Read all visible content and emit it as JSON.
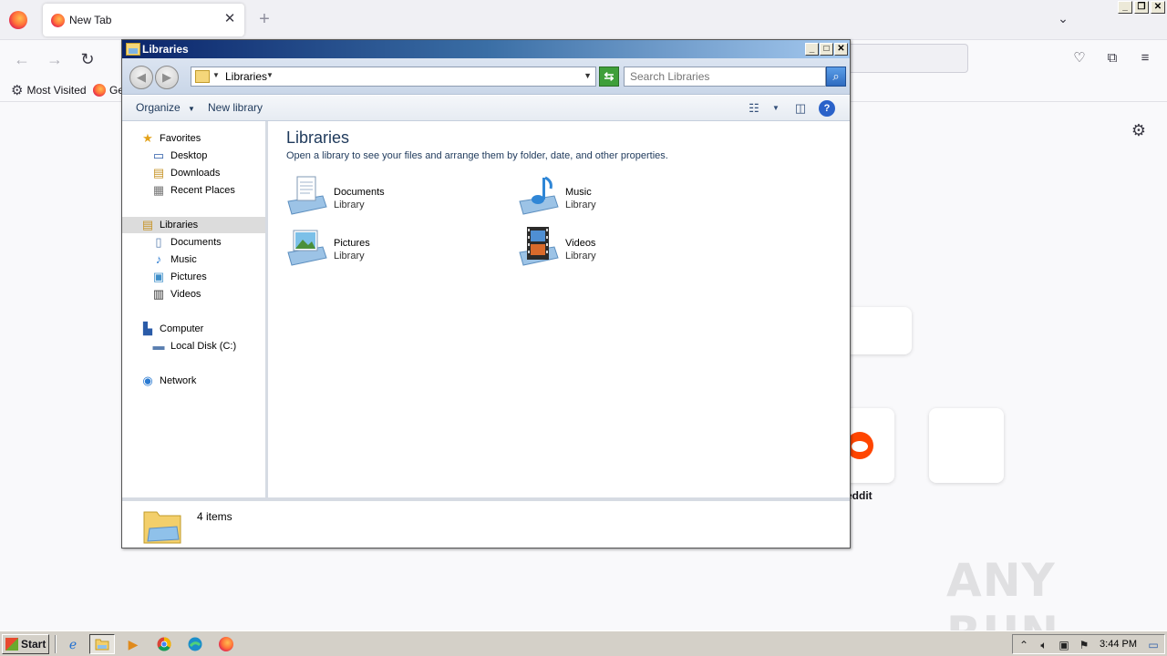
{
  "firefox": {
    "tab_title": "New Tab",
    "tab_close": "✕",
    "new_tab": "+",
    "bookmarks": [
      {
        "label": "Most Visited",
        "icon": "gear-icon"
      },
      {
        "label": "Ge",
        "icon": "firefox-icon"
      }
    ],
    "tiles": [
      {
        "label": "eddit",
        "icon": "reddit-icon"
      }
    ]
  },
  "explorer": {
    "title": "Libraries",
    "address_text": "Libraries",
    "search_placeholder": "Search Libraries",
    "toolbar": {
      "organize": "Organize",
      "new_library": "New library"
    },
    "nav": {
      "favorites": "Favorites",
      "favorites_items": [
        "Desktop",
        "Downloads",
        "Recent Places"
      ],
      "libraries": "Libraries",
      "libraries_items": [
        "Documents",
        "Music",
        "Pictures",
        "Videos"
      ],
      "computer": "Computer",
      "computer_items": [
        "Local Disk (C:)"
      ],
      "network": "Network"
    },
    "content": {
      "heading": "Libraries",
      "description": "Open a library to see your files and arrange them by folder, date, and other properties.",
      "libraries": [
        {
          "name": "Documents",
          "sub": "Library",
          "icon": "documents-library-icon"
        },
        {
          "name": "Music",
          "sub": "Library",
          "icon": "music-library-icon"
        },
        {
          "name": "Pictures",
          "sub": "Library",
          "icon": "pictures-library-icon"
        },
        {
          "name": "Videos",
          "sub": "Library",
          "icon": "videos-library-icon"
        }
      ]
    },
    "details": {
      "count": "4 items"
    }
  },
  "taskbar": {
    "start": "Start",
    "time": "3:44 PM",
    "apps": [
      "internet-explorer-icon",
      "explorer-icon",
      "media-player-icon",
      "chrome-icon",
      "edge-icon",
      "firefox-icon"
    ]
  },
  "watermark": "ANY RUN",
  "colors": {
    "xp_title_start": "#0a246a",
    "xp_title_end": "#a6caf0",
    "explorer_text": "#1e395b",
    "reddit": "#ff4500"
  }
}
